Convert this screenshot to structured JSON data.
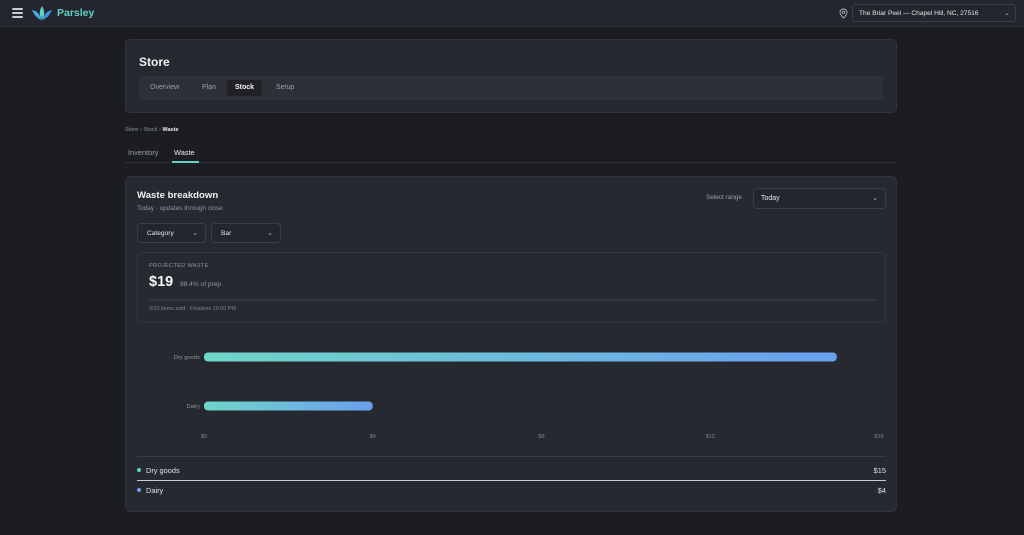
{
  "app": {
    "name": "Parsley",
    "location": "The Briar Peel — Chapel Hill, NC, 27516"
  },
  "store": {
    "title": "Store",
    "tabs": [
      {
        "label": "Overview",
        "active": false
      },
      {
        "label": "Plan",
        "active": false
      },
      {
        "label": "Stock",
        "active": true
      },
      {
        "label": "Setup",
        "active": false
      }
    ]
  },
  "breadcrumb": {
    "items": [
      "Store",
      "Stock"
    ],
    "current": "Waste",
    "sep": "›"
  },
  "subtabs": [
    {
      "label": "Inventory",
      "active": false
    },
    {
      "label": "Waste",
      "active": true
    }
  ],
  "waste": {
    "title": "Waste breakdown",
    "subtitle": "Today · updates through close",
    "range_label": "Select range",
    "range_value": "Today",
    "group_by": "Category",
    "view": "Bar",
    "projected_label": "PROJECTED WASTE",
    "projected_value": "$19",
    "projected_pct": "98.4% of prep",
    "progress": 0,
    "footnote": "0/20 items sold · Finalizes 10:00 PM"
  },
  "colors": {
    "accent": "#5fd3c6",
    "dry_goods": "#5fd3c6",
    "dairy": "#6a9ff0",
    "bar_start": "#6fd6c8",
    "bar_end": "#6a9ff0"
  },
  "chart_data": {
    "type": "bar",
    "orientation": "horizontal",
    "categories": [
      "Dry goods",
      "Dairy"
    ],
    "values": [
      15,
      4
    ],
    "xlim": [
      0,
      16
    ],
    "xticks": [
      0,
      4,
      8,
      12,
      16
    ],
    "xtick_labels": [
      "$0",
      "$4",
      "$8",
      "$12",
      "$16"
    ],
    "grid": false,
    "legend": [
      {
        "name": "Dry goods",
        "value": "$15"
      },
      {
        "name": "Dairy",
        "value": "$4"
      }
    ]
  }
}
